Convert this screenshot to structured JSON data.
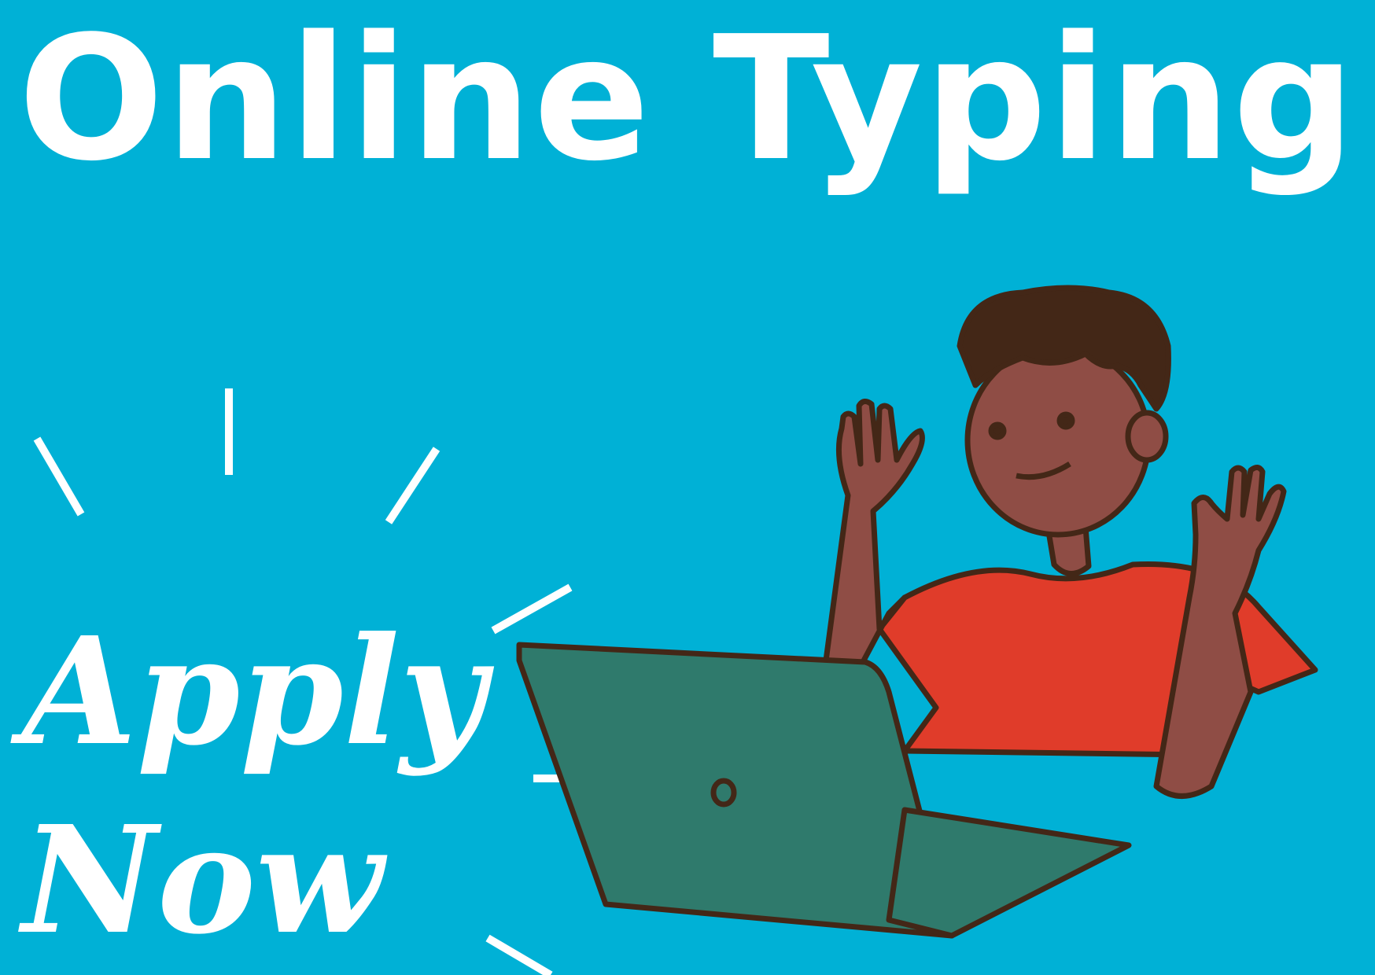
{
  "headline": "Online Typing",
  "cta": {
    "line1": "Apply",
    "line2": "Now"
  },
  "colors": {
    "background": "#00b1d6",
    "text": "#ffffff",
    "shirt": "#e03c2a",
    "skin": "#8f4d45",
    "hair": "#432717",
    "laptop": "#2f7a6c",
    "outline": "#432717"
  },
  "illustration": "person-waving-at-laptop"
}
